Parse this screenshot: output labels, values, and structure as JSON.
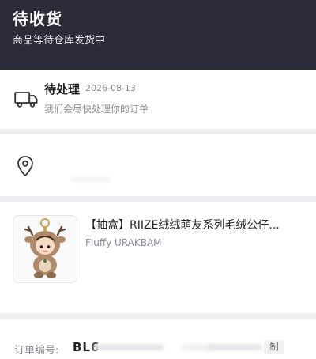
{
  "header": {
    "title": "待收货",
    "subtitle": "商品等待仓库发货中"
  },
  "status": {
    "label": "待处理",
    "date": "2026-08-13",
    "description": "我们会尽快处理你的订单",
    "icon": "truck-icon"
  },
  "address": {
    "icon": "location-pin-icon"
  },
  "product": {
    "title": "【抽盒】RIIZE绒绒萌友系列毛绒公仔...",
    "variant": "Fluffy URAKBAM",
    "thumbnail": "plush-doll-image"
  },
  "order": {
    "label": "订单编号:",
    "number_prefix": "BL6",
    "copy_label": "制"
  },
  "colors": {
    "header_bg": "#2b2b3a",
    "page_bg": "#efeff1",
    "card_bg": "#ffffff",
    "primary_text": "#222222",
    "secondary_text": "#8a8a93"
  }
}
